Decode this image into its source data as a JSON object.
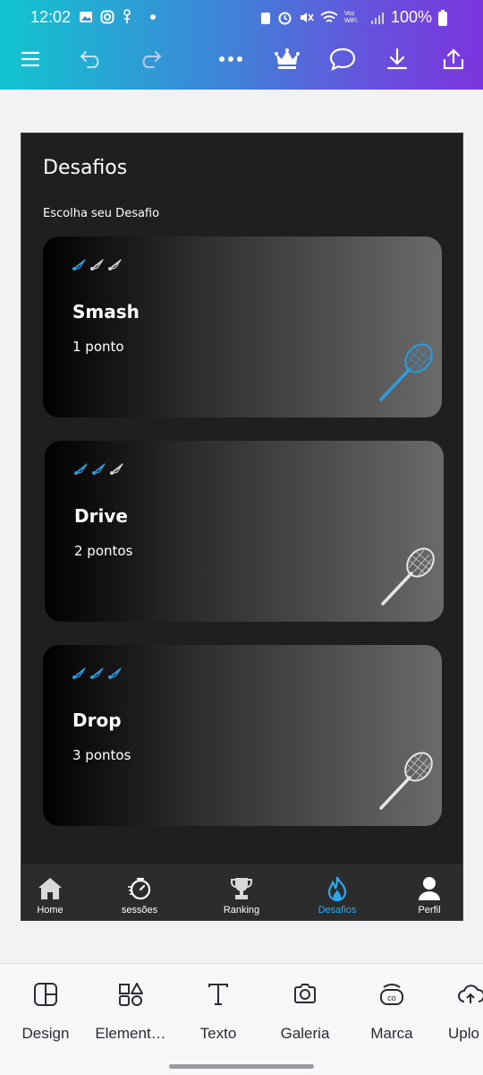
{
  "status_bar": {
    "time": "12:02",
    "battery": "100%",
    "wifi_label": "Voz WiFi"
  },
  "editor_toolbar": {
    "icons": [
      "menu-icon",
      "undo-icon",
      "redo-icon",
      "more-icon",
      "crown-icon",
      "comment-icon",
      "download-icon",
      "share-icon"
    ]
  },
  "design": {
    "title": "Desafios",
    "subtitle": "Escolha seu Desafio",
    "cards": [
      {
        "title": "Smash",
        "points": "1 ponto",
        "level": 1,
        "racket_color": "#2d9ce0"
      },
      {
        "title": "Drive",
        "points": "2 pontos",
        "level": 2,
        "racket_color": "#e6e6e6"
      },
      {
        "title": "Drop",
        "points": "3 pontos",
        "level": 3,
        "racket_color": "#e6e6e6"
      }
    ],
    "nav": [
      {
        "label": "Home",
        "icon": "home-icon"
      },
      {
        "label": "sessões",
        "icon": "stopwatch-icon"
      },
      {
        "label": "Ranking",
        "icon": "trophy-icon"
      },
      {
        "label": "Desafios",
        "icon": "flame-icon",
        "active": true
      },
      {
        "label": "Perfil",
        "icon": "user-icon"
      }
    ],
    "accent": "#2da8f0"
  },
  "bottom_tabs": [
    {
      "label": "Design",
      "icon": "layout-icon"
    },
    {
      "label": "Element…",
      "icon": "shapes-icon"
    },
    {
      "label": "Texto",
      "icon": "text-icon"
    },
    {
      "label": "Galeria",
      "icon": "camera-icon"
    },
    {
      "label": "Marca",
      "icon": "brand-icon"
    },
    {
      "label": "Uplo",
      "icon": "upload-cloud-icon"
    }
  ]
}
